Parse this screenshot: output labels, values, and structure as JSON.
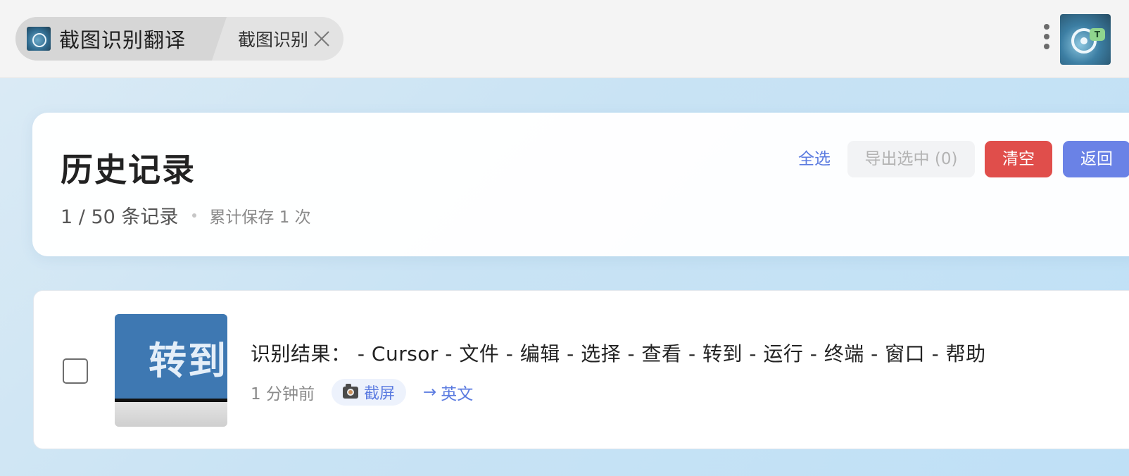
{
  "tabs": [
    {
      "label": "截图识别翻译",
      "icon": "app-logo-icon",
      "active": true
    },
    {
      "label": "截图识别",
      "icon": "close-icon",
      "active": false
    }
  ],
  "toolbar": {
    "more_icon": "more-vertical-icon",
    "logo_badge": "T"
  },
  "header": {
    "title": "历史记录",
    "count": "1 / 50 条记录",
    "saved": "累计保存 1 次",
    "buttons": {
      "select_all": "全选",
      "export": "导出选中 (0)",
      "clear": "清空",
      "back": "返回"
    }
  },
  "records": [
    {
      "thumbnail_text": "转到",
      "result": "识别结果： - Cursor - 文件 - 编辑 - 选择 - 查看 - 转到 - 运行 - 终端 - 窗口 - 帮助",
      "time": "1 分钟前",
      "source": "截屏",
      "target_lang": "英文",
      "selected": false
    }
  ],
  "colors": {
    "accent": "#5b7be0",
    "danger": "#e04e4b",
    "primary": "#6a82e6"
  }
}
